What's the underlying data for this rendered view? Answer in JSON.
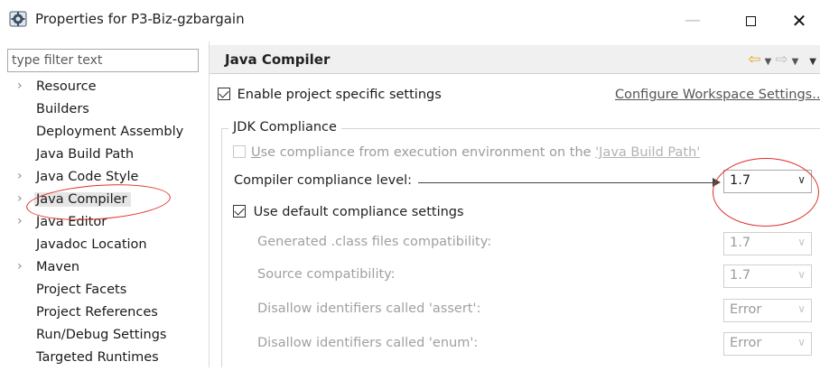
{
  "window": {
    "title": "Properties for P3-Biz-gzbargain",
    "minimize_glyph": "—",
    "close_glyph": "✕"
  },
  "sidebar": {
    "filter_placeholder": "type filter text",
    "items": [
      {
        "label": "Resource",
        "expandable": true
      },
      {
        "label": "Builders",
        "expandable": false
      },
      {
        "label": "Deployment Assembly",
        "expandable": false
      },
      {
        "label": "Java Build Path",
        "expandable": false
      },
      {
        "label": "Java Code Style",
        "expandable": true
      },
      {
        "label": "Java Compiler",
        "expandable": true,
        "selected": true
      },
      {
        "label": "Java Editor",
        "expandable": true
      },
      {
        "label": "Javadoc Location",
        "expandable": false
      },
      {
        "label": "Maven",
        "expandable": true
      },
      {
        "label": "Project Facets",
        "expandable": false
      },
      {
        "label": "Project References",
        "expandable": false
      },
      {
        "label": "Run/Debug Settings",
        "expandable": false
      },
      {
        "label": "Targeted Runtimes",
        "expandable": false
      }
    ],
    "expand_arrow_glyph": "›"
  },
  "page": {
    "title": "Java Compiler",
    "nav": {
      "back_icon": "back-arrow-icon",
      "forward_icon": "forward-arrow-icon",
      "caret_glyph": "▼",
      "menu_glyph": "▼"
    },
    "enable_specific_settings": {
      "label": "Enable project specific settings",
      "checked": true
    },
    "configure_link": "Configure Workspace Settings...",
    "jdk_compliance": {
      "group_title": "JDK Compliance",
      "use_compliance": {
        "prefix_underlined": "U",
        "text": "se compliance from execution environment on the ",
        "link": "'Java Build Path'",
        "checked": false,
        "enabled": false
      },
      "compliance_level": {
        "label": "Compiler compliance level:",
        "value": "1.7"
      },
      "use_default": {
        "label": "Use default compliance settings",
        "checked": true
      },
      "settings": [
        {
          "label": "Generated .class files compatibility:",
          "value": "1.7"
        },
        {
          "label": "Source compatibility:",
          "value": "1.7"
        },
        {
          "label": "Disallow identifiers called 'assert':",
          "value": "Error"
        },
        {
          "label": "Disallow identifiers called 'enum':",
          "value": "Error"
        }
      ]
    },
    "chevron_glyph": "∨"
  },
  "colors": {
    "annotation": "#e0302b",
    "header_bg": "#f0f0f0",
    "nav_back": "#e8a326"
  }
}
